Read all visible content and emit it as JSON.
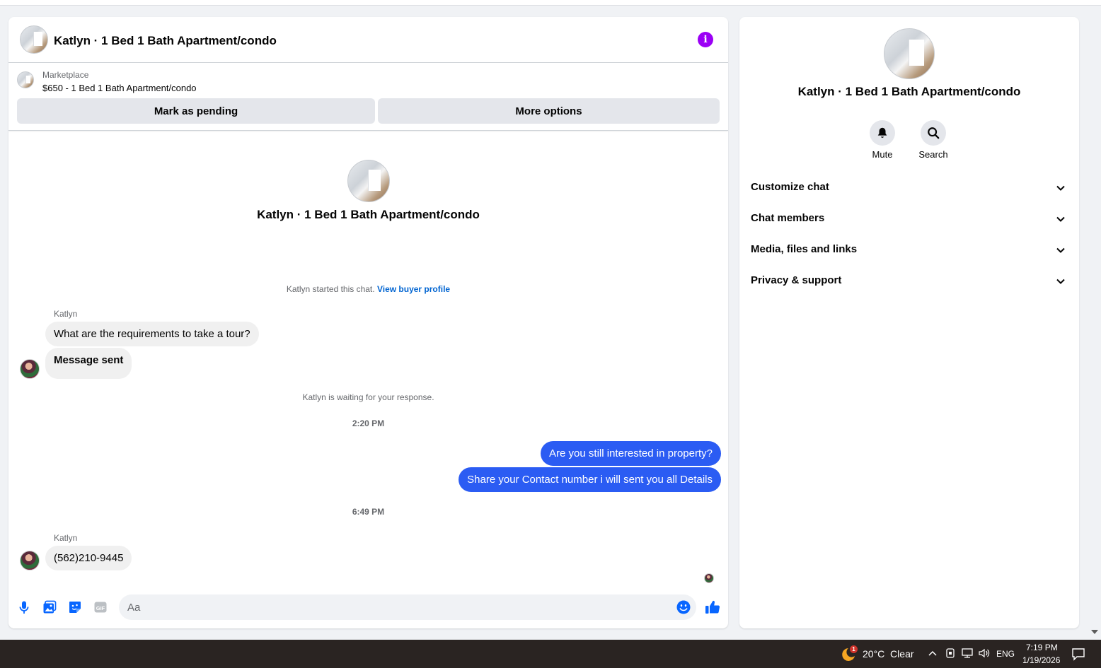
{
  "chat": {
    "title": "Katlyn · 1 Bed 1 Bath Apartment/condo",
    "marketplace_label": "Marketplace",
    "listing": "$650 - 1 Bed 1 Bath Apartment/condo",
    "mark_pending_label": "Mark as pending",
    "more_options_label": "More options",
    "center_name": "Katlyn · 1 Bed 1 Bath Apartment/condo",
    "started_text": "Katlyn started this chat.",
    "view_profile_label": "View buyer profile",
    "waiting_text": "Katlyn is waiting for your response.",
    "messages": [
      {
        "sender": "Katlyn",
        "text": "What are the requirements to take a tour?"
      },
      {
        "text": "Message sent"
      },
      {
        "time": "2:20 PM"
      },
      {
        "text": "Are you still interested in property?"
      },
      {
        "text": "Share your Contact number i will sent you all Details"
      },
      {
        "time": "6:49 PM"
      },
      {
        "sender": "Katlyn",
        "text": "(562)210-9445"
      }
    ],
    "composer_placeholder": "Aa"
  },
  "side": {
    "name": "Katlyn · 1 Bed 1 Bath Apartment/condo",
    "mute_label": "Mute",
    "search_label": "Search",
    "sections": [
      "Customize chat",
      "Chat members",
      "Media, files and links",
      "Privacy & support"
    ]
  },
  "taskbar": {
    "weather_badge": "1",
    "weather": "20°C  Clear",
    "lang": "ENG",
    "time": "7:19 PM",
    "date": "1/19/2026"
  },
  "colors": {
    "outgoing_bubble": "#2b5cf3",
    "info_icon": "#9b00f5",
    "link": "#0064d1",
    "composer_icons": "#0866ff"
  }
}
